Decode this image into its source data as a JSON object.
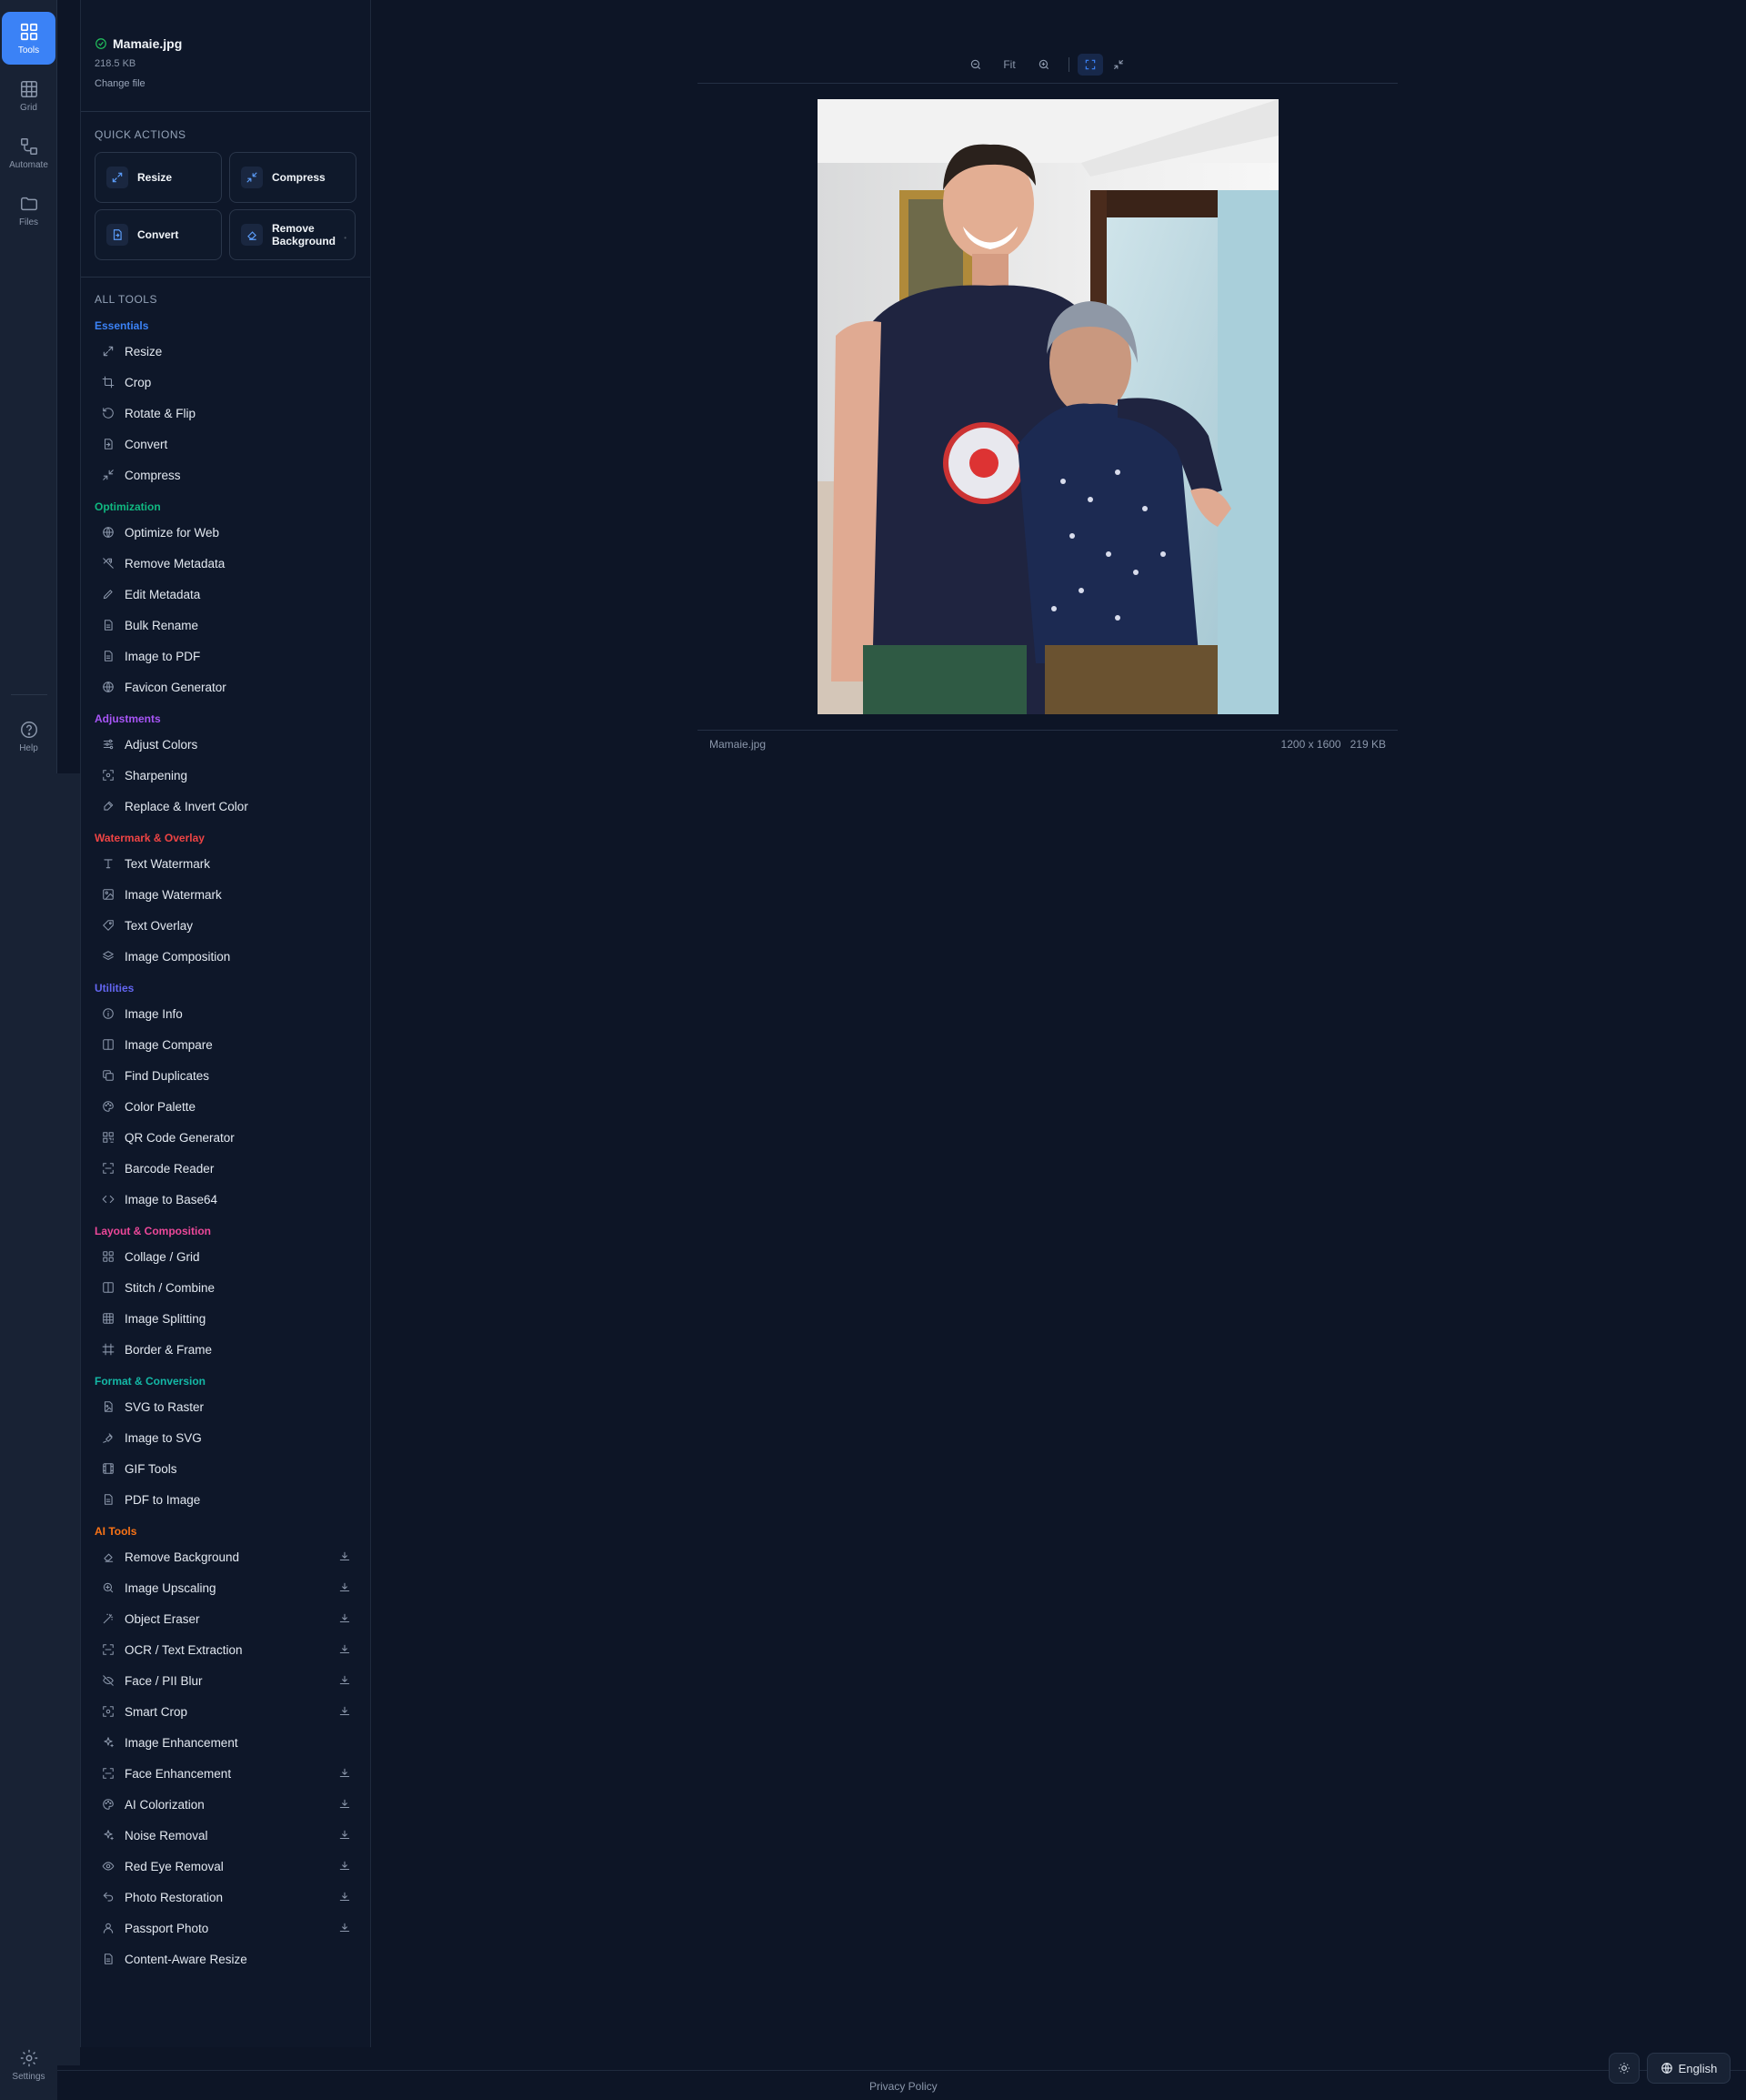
{
  "rail": {
    "items": [
      {
        "label": "Tools"
      },
      {
        "label": "Grid"
      },
      {
        "label": "Automate"
      },
      {
        "label": "Files"
      }
    ],
    "help": "Help",
    "settings": "Settings"
  },
  "file": {
    "name": "Mamaie.jpg",
    "size": "218.5 KB",
    "change": "Change file"
  },
  "quick_actions": {
    "title": "QUICK ACTIONS",
    "items": [
      {
        "label": "Resize",
        "icon": "resize-icon"
      },
      {
        "label": "Compress",
        "icon": "compress-icon"
      },
      {
        "label": "Convert",
        "icon": "convert-icon"
      },
      {
        "label": "Remove Background",
        "icon": "eraser-icon"
      }
    ]
  },
  "all_tools": {
    "title": "ALL TOOLS",
    "categories": [
      {
        "name": "Essentials",
        "color": "#3b82f6",
        "tools": [
          {
            "label": "Resize",
            "icon": "resize"
          },
          {
            "label": "Crop",
            "icon": "crop"
          },
          {
            "label": "Rotate & Flip",
            "icon": "rotate"
          },
          {
            "label": "Convert",
            "icon": "convert"
          },
          {
            "label": "Compress",
            "icon": "compress"
          }
        ]
      },
      {
        "name": "Optimization",
        "color": "#10b981",
        "tools": [
          {
            "label": "Optimize for Web",
            "icon": "globe"
          },
          {
            "label": "Remove Metadata",
            "icon": "tag-off"
          },
          {
            "label": "Edit Metadata",
            "icon": "pencil"
          },
          {
            "label": "Bulk Rename",
            "icon": "file"
          },
          {
            "label": "Image to PDF",
            "icon": "file"
          },
          {
            "label": "Favicon Generator",
            "icon": "globe"
          }
        ]
      },
      {
        "name": "Adjustments",
        "color": "#a855f7",
        "tools": [
          {
            "label": "Adjust Colors",
            "icon": "sliders"
          },
          {
            "label": "Sharpening",
            "icon": "focus"
          },
          {
            "label": "Replace & Invert Color",
            "icon": "pipette"
          }
        ]
      },
      {
        "name": "Watermark & Overlay",
        "color": "#ef4444",
        "tools": [
          {
            "label": "Text Watermark",
            "icon": "type"
          },
          {
            "label": "Image Watermark",
            "icon": "image"
          },
          {
            "label": "Text Overlay",
            "icon": "tag"
          },
          {
            "label": "Image Composition",
            "icon": "layers"
          }
        ]
      },
      {
        "name": "Utilities",
        "color": "#6366f1",
        "tools": [
          {
            "label": "Image Info",
            "icon": "info"
          },
          {
            "label": "Image Compare",
            "icon": "columns"
          },
          {
            "label": "Find Duplicates",
            "icon": "copy"
          },
          {
            "label": "Color Palette",
            "icon": "palette"
          },
          {
            "label": "QR Code Generator",
            "icon": "qr"
          },
          {
            "label": "Barcode Reader",
            "icon": "scan"
          },
          {
            "label": "Image to Base64",
            "icon": "code"
          }
        ]
      },
      {
        "name": "Layout & Composition",
        "color": "#ec4899",
        "tools": [
          {
            "label": "Collage / Grid",
            "icon": "grid4"
          },
          {
            "label": "Stitch / Combine",
            "icon": "columns"
          },
          {
            "label": "Image Splitting",
            "icon": "grid9"
          },
          {
            "label": "Border & Frame",
            "icon": "frame"
          }
        ]
      },
      {
        "name": "Format & Conversion",
        "color": "#14b8a6",
        "tools": [
          {
            "label": "SVG to Raster",
            "icon": "file-image"
          },
          {
            "label": "Image to SVG",
            "icon": "pen"
          },
          {
            "label": "GIF Tools",
            "icon": "film"
          },
          {
            "label": "PDF to Image",
            "icon": "file"
          }
        ]
      },
      {
        "name": "AI Tools",
        "color": "#f97316",
        "tools": [
          {
            "label": "Remove Background",
            "icon": "eraser",
            "download": true
          },
          {
            "label": "Image Upscaling",
            "icon": "zoom",
            "download": true
          },
          {
            "label": "Object Eraser",
            "icon": "wand",
            "download": true
          },
          {
            "label": "OCR / Text Extraction",
            "icon": "scan",
            "download": true
          },
          {
            "label": "Face / PII Blur",
            "icon": "eye-off",
            "download": true
          },
          {
            "label": "Smart Crop",
            "icon": "focus",
            "download": true
          },
          {
            "label": "Image Enhancement",
            "icon": "sparkles",
            "download": false
          },
          {
            "label": "Face Enhancement",
            "icon": "scan",
            "download": true
          },
          {
            "label": "AI Colorization",
            "icon": "palette",
            "download": true
          },
          {
            "label": "Noise Removal",
            "icon": "sparkles",
            "download": true
          },
          {
            "label": "Red Eye Removal",
            "icon": "eye",
            "download": true
          },
          {
            "label": "Photo Restoration",
            "icon": "undo",
            "download": true
          },
          {
            "label": "Passport Photo",
            "icon": "user",
            "download": true
          },
          {
            "label": "Content-Aware Resize",
            "icon": "file",
            "download": false
          }
        ]
      }
    ]
  },
  "viewer": {
    "fit_label": "Fit",
    "footer_name": "Mamaie.jpg",
    "footer_dims": "1200 x 1600",
    "footer_size": "219 KB"
  },
  "footer": {
    "privacy": "Privacy Policy",
    "language": "English"
  }
}
